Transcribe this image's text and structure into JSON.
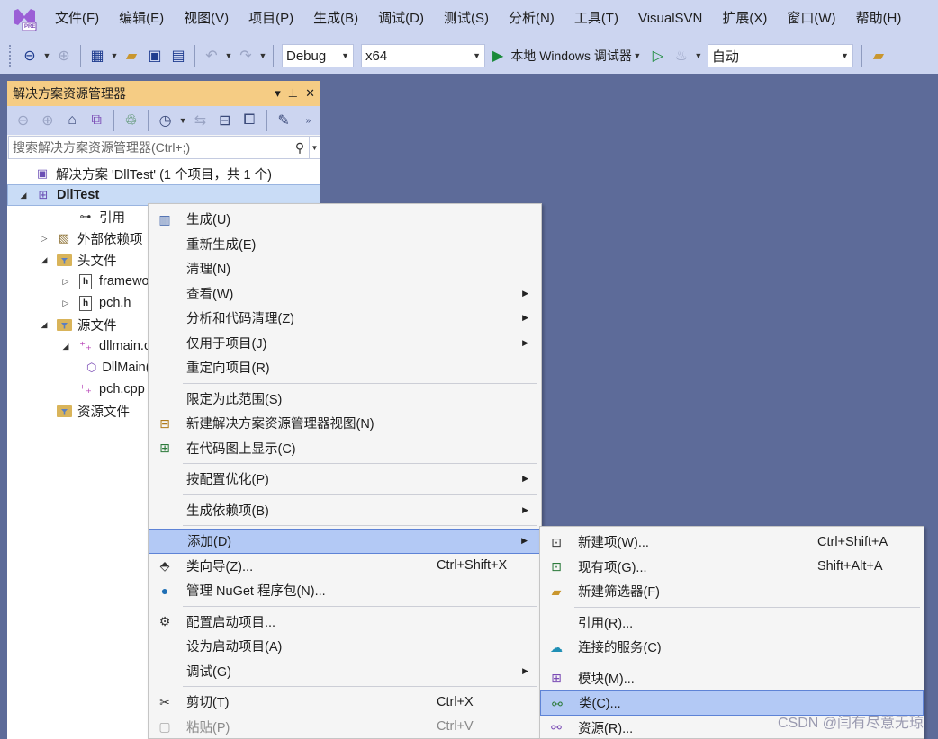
{
  "menubar": {
    "logo_badge": "PRE",
    "items": [
      "文件(F)",
      "编辑(E)",
      "视图(V)",
      "项目(P)",
      "生成(B)",
      "调试(D)",
      "测试(S)",
      "分析(N)",
      "工具(T)",
      "VisualSVN",
      "扩展(X)",
      "窗口(W)",
      "帮助(H)"
    ]
  },
  "toolbar": {
    "config": "Debug",
    "platform": "x64",
    "run_label": "本地 Windows 调试器",
    "auto_label": "自动"
  },
  "solution_explorer": {
    "title": "解决方案资源管理器",
    "search_placeholder": "搜索解决方案资源管理器(Ctrl+;)",
    "tree": [
      {
        "label": "解决方案 'DllTest' (1 个项目，共 1 个)",
        "indent": 0,
        "expander": "",
        "icon": "solution-icon"
      },
      {
        "label": "DllTest",
        "indent": 0,
        "expander": "◢",
        "icon": "project-icon",
        "selected": true
      },
      {
        "label": "引用",
        "indent": 2,
        "expander": "",
        "icon": "references-icon"
      },
      {
        "label": "外部依赖项",
        "indent": 1,
        "expander": "▷",
        "icon": "external-deps-icon"
      },
      {
        "label": "头文件",
        "indent": 1,
        "expander": "◢",
        "icon": "filter-folder-icon"
      },
      {
        "label": "framework.h",
        "indent": 2,
        "expander": "▷",
        "icon": "header-file-icon"
      },
      {
        "label": "pch.h",
        "indent": 2,
        "expander": "▷",
        "icon": "header-file-icon"
      },
      {
        "label": "源文件",
        "indent": 1,
        "expander": "◢",
        "icon": "filter-folder-icon"
      },
      {
        "label": "dllmain.cpp",
        "indent": 2,
        "expander": "◢",
        "icon": "cpp-file-icon"
      },
      {
        "label": "DllMain(HMODULE hModule, DWORD ul_reason_for_call, LPVOID lpReserved)",
        "indent": 3,
        "expander": "",
        "icon": "function-icon"
      },
      {
        "label": "pch.cpp",
        "indent": 2,
        "expander": "",
        "icon": "cpp-file-icon"
      },
      {
        "label": "资源文件",
        "indent": 1,
        "expander": "",
        "icon": "filter-folder-icon"
      }
    ]
  },
  "context_menu": {
    "items": [
      {
        "label": "生成(U)",
        "icon": "build-icon"
      },
      {
        "label": "重新生成(E)"
      },
      {
        "label": "清理(N)"
      },
      {
        "label": "查看(W)",
        "submenu": true
      },
      {
        "label": "分析和代码清理(Z)",
        "submenu": true
      },
      {
        "label": "仅用于项目(J)",
        "submenu": true
      },
      {
        "label": "重定向项目(R)"
      },
      {
        "sep": true
      },
      {
        "label": "限定为此范围(S)"
      },
      {
        "label": "新建解决方案资源管理器视图(N)",
        "icon": "new-view-icon"
      },
      {
        "label": "在代码图上显示(C)",
        "icon": "code-map-icon"
      },
      {
        "sep": true
      },
      {
        "label": "按配置优化(P)",
        "submenu": true
      },
      {
        "sep": true
      },
      {
        "label": "生成依赖项(B)",
        "submenu": true
      },
      {
        "sep": true
      },
      {
        "label": "添加(D)",
        "submenu": true,
        "highlight": true
      },
      {
        "label": "类向导(Z)...",
        "icon": "class-wizard-icon",
        "shortcut": "Ctrl+Shift+X"
      },
      {
        "label": "管理 NuGet 程序包(N)...",
        "icon": "nuget-icon"
      },
      {
        "sep": true
      },
      {
        "label": "配置启动项目...",
        "icon": "gear-icon"
      },
      {
        "label": "设为启动项目(A)"
      },
      {
        "label": "调试(G)",
        "submenu": true
      },
      {
        "sep": true
      },
      {
        "label": "剪切(T)",
        "icon": "scissors-icon",
        "shortcut": "Ctrl+X"
      },
      {
        "label": "粘贴(P)",
        "icon": "paste-icon",
        "shortcut": "Ctrl+V",
        "disabled": true
      }
    ]
  },
  "add_submenu": {
    "items": [
      {
        "label": "新建项(W)...",
        "icon": "new-item-icon",
        "shortcut": "Ctrl+Shift+A"
      },
      {
        "label": "现有项(G)...",
        "icon": "existing-item-icon",
        "shortcut": "Shift+Alt+A"
      },
      {
        "label": "新建筛选器(F)",
        "icon": "new-filter-icon"
      },
      {
        "sep": true
      },
      {
        "label": "引用(R)..."
      },
      {
        "label": "连接的服务(C)",
        "icon": "connected-service-icon"
      },
      {
        "sep": true
      },
      {
        "label": "模块(M)...",
        "icon": "module-icon"
      },
      {
        "label": "类(C)...",
        "icon": "class-icon",
        "highlight": true
      },
      {
        "label": "资源(R)...",
        "icon": "resource-icon"
      }
    ]
  },
  "watermark": "CSDN @闫有尽意无琼"
}
